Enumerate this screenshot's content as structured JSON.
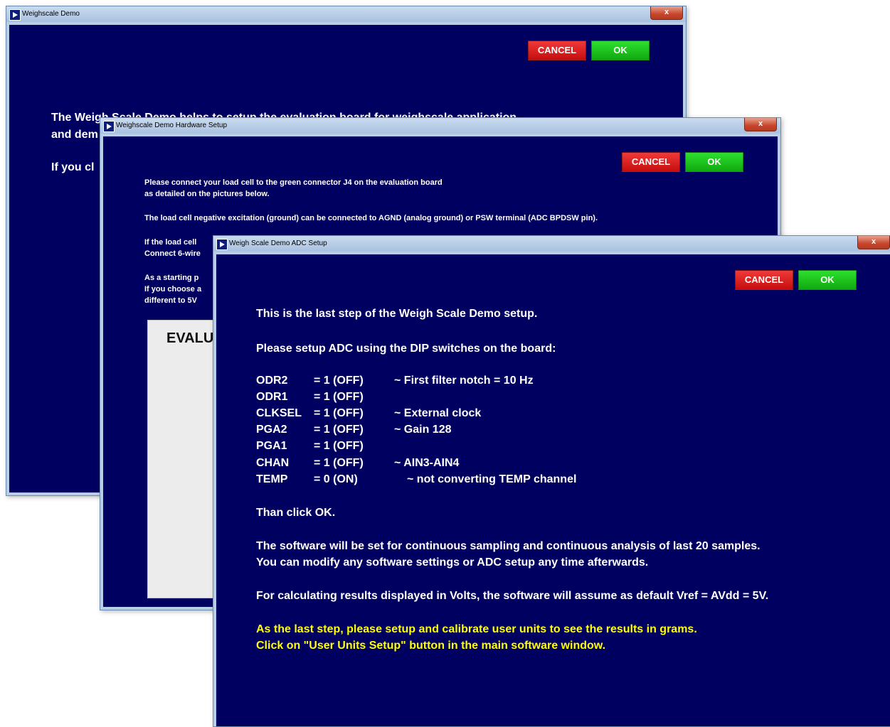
{
  "window1": {
    "title": "Weighscale Demo",
    "close": "x",
    "cancel": "CANCEL",
    "ok": "OK",
    "text_line1": "The Weigh Scale Demo helps to setup the evaluation board for weighscale application",
    "text_line2": "and dem",
    "text_line3": "If you cl"
  },
  "window2": {
    "title": "Weighscale Demo Hardware Setup",
    "close": "x",
    "cancel": "CANCEL",
    "ok": "OK",
    "line1": "Please connect your load cell to the green connector J4 on the evaluation board",
    "line2": "as detailed on the pictures below.",
    "line3": "The load cell negative excitation (ground) can be connected to AGND (analog ground) or PSW terminal (ADC BPDSW pin).",
    "line4": "If the load cell",
    "line5": "Connect 6-wire",
    "line6": "As a starting p",
    "line7": "If you choose a",
    "line8": "different to 5V",
    "image_text": "EVALU"
  },
  "window3": {
    "title": "Weigh Scale Demo ADC Setup",
    "close": "x",
    "cancel": "CANCEL",
    "ok": "OK",
    "intro": "This is the last step of the Weigh Scale Demo setup.",
    "setup": "Please setup ADC using the DIP switches on the board:",
    "switches": [
      {
        "name": "ODR2",
        "value": "= 1 (OFF)",
        "note": "~ First filter notch = 10 Hz"
      },
      {
        "name": "ODR1",
        "value": "= 1 (OFF)",
        "note": ""
      },
      {
        "name": "CLKSEL",
        "value": "= 1 (OFF)",
        "note": "~ External clock"
      },
      {
        "name": "PGA2",
        "value": "= 1 (OFF)",
        "note": "~ Gain 128"
      },
      {
        "name": "PGA1",
        "value": "= 1 (OFF)",
        "note": ""
      },
      {
        "name": "CHAN",
        "value": "= 1 (OFF)",
        "note": "~ AIN3-AIN4"
      },
      {
        "name": "TEMP",
        "value": "= 0 (ON)",
        "note": "~ not converting TEMP channel"
      }
    ],
    "then": "Than click OK.",
    "para1_line1": "The software will be set for continuous sampling and continuous analysis of last 20 samples.",
    "para1_line2": "You can modify any software settings or ADC setup any time afterwards.",
    "para2": "For calculating results displayed in Volts, the software will assume as default Vref = AVdd = 5V.",
    "note_line1": "As the last step, please setup and calibrate user units to see the results in grams.",
    "note_line2": "Click on \"User Units Setup\" button in the main software window."
  },
  "colors": {
    "client_bg": "#000060",
    "cancel_red": "#e01818",
    "ok_green": "#20c020",
    "note_yellow": "#ffff00"
  }
}
